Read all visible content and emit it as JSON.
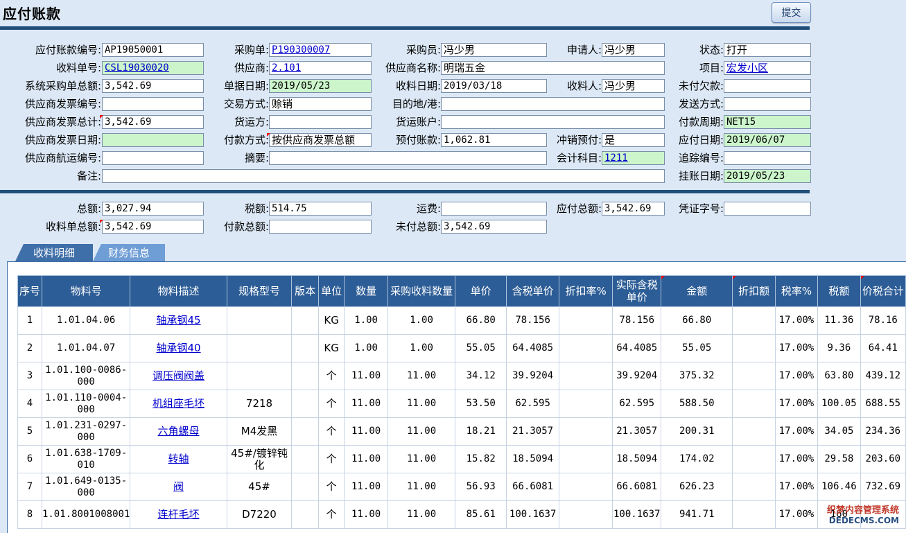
{
  "header": {
    "title": "应付账款",
    "submit_label": "提交"
  },
  "form": {
    "ap_no": {
      "label": "应付账款编号:",
      "value": "AP19050001"
    },
    "po": {
      "label": "采购单:",
      "value": "P190300007"
    },
    "buyer": {
      "label": "采购员:",
      "value": "冯少男"
    },
    "requester": {
      "label": "申请人:",
      "value": "冯少男"
    },
    "status": {
      "label": "状态:",
      "value": "打开"
    },
    "receipt_no": {
      "label": "收料单号:",
      "value": "CSL19030020"
    },
    "supplier": {
      "label": "供应商:",
      "value": "2.101"
    },
    "supplier_name": {
      "label": "供应商名称:",
      "value": "明瑞五金"
    },
    "project": {
      "label": "项目:",
      "value": "宏发小区"
    },
    "sys_po_total": {
      "label": "系统采购单总额:",
      "value": "3,542.69"
    },
    "doc_date": {
      "label": "单据日期:",
      "value": "2019/05/23"
    },
    "receipt_date": {
      "label": "收料日期:",
      "value": "2019/03/18"
    },
    "receiver": {
      "label": "收料人:",
      "value": "冯少男"
    },
    "unpaid_debt": {
      "label": "未付欠款:",
      "value": ""
    },
    "supplier_invoice_no": {
      "label": "供应商发票编号:",
      "value": ""
    },
    "trade_method": {
      "label": "交易方式:",
      "value": "赊销"
    },
    "destination": {
      "label": "目的地/港:",
      "value": ""
    },
    "ship_method": {
      "label": "发送方式:",
      "value": ""
    },
    "supplier_invoice_total": {
      "label": "供应商发票总计:",
      "value": "3,542.69"
    },
    "carrier": {
      "label": "货运方:",
      "value": ""
    },
    "freight_account": {
      "label": "货运账户:",
      "value": ""
    },
    "payment_term": {
      "label": "付款周期:",
      "value": "NET15"
    },
    "supplier_invoice_date": {
      "label": "供应商发票日期:",
      "value": ""
    },
    "payment_method": {
      "label": "付款方式:",
      "value": "按供应商发票总额"
    },
    "prepaid": {
      "label": "预付账款:",
      "value": "1,062.81"
    },
    "offset_prepaid": {
      "label": "冲销预付:",
      "value": "是"
    },
    "due_date": {
      "label": "应付日期:",
      "value": "2019/06/07"
    },
    "supplier_shipping_no": {
      "label": "供应商航运编号:",
      "value": ""
    },
    "summary": {
      "label": "摘要:",
      "value": ""
    },
    "account_subject": {
      "label": "会计科目:",
      "value": "1211"
    },
    "tracking_no": {
      "label": "追踪编号:",
      "value": ""
    },
    "remark": {
      "label": "备注:",
      "value": ""
    },
    "posting_date": {
      "label": "挂账日期:",
      "value": "2019/05/23"
    }
  },
  "totals": {
    "total": {
      "label": "总额:",
      "value": "3,027.94"
    },
    "tax": {
      "label": "税额:",
      "value": "514.75"
    },
    "freight": {
      "label": "运费:",
      "value": ""
    },
    "payable_total": {
      "label": "应付总额:",
      "value": "3,542.69"
    },
    "voucher_no": {
      "label": "凭证字号:",
      "value": ""
    },
    "receipt_total": {
      "label": "收料单总额:",
      "value": "3,542.69"
    },
    "paid_total": {
      "label": "付款总额:",
      "value": ""
    },
    "unpaid_total": {
      "label": "未付总额:",
      "value": "3,542.69"
    }
  },
  "tabs": [
    {
      "label": "收料明细",
      "active": true
    },
    {
      "label": "财务信息",
      "active": false
    }
  ],
  "table": {
    "columns": [
      "序号",
      "物料号",
      "物料描述",
      "规格型号",
      "版本",
      "单位",
      "数量",
      "采购收料数量",
      "单价",
      "含税单价",
      "折扣率%",
      "实际含税单价",
      "金额",
      "折扣额",
      "税率%",
      "税额",
      "价税合计"
    ],
    "rows": [
      [
        "1",
        "1.01.04.06",
        "轴承钢45",
        "",
        "",
        "KG",
        "1.00",
        "1.00",
        "66.80",
        "78.156",
        "",
        "78.156",
        "66.80",
        "",
        "17.00%",
        "11.36",
        "78.16"
      ],
      [
        "2",
        "1.01.04.07",
        "轴承钢40",
        "",
        "",
        "KG",
        "1.00",
        "1.00",
        "55.05",
        "64.4085",
        "",
        "64.4085",
        "55.05",
        "",
        "17.00%",
        "9.36",
        "64.41"
      ],
      [
        "3",
        "1.01.100-0086-000",
        "调压阀阀盖",
        "",
        "",
        "个",
        "11.00",
        "11.00",
        "34.12",
        "39.9204",
        "",
        "39.9204",
        "375.32",
        "",
        "17.00%",
        "63.80",
        "439.12"
      ],
      [
        "4",
        "1.01.110-0004-000",
        "机组座毛坯",
        "7218",
        "",
        "个",
        "11.00",
        "11.00",
        "53.50",
        "62.595",
        "",
        "62.595",
        "588.50",
        "",
        "17.00%",
        "100.05",
        "688.55"
      ],
      [
        "5",
        "1.01.231-0297-000",
        "六角螺母",
        "M4发黑",
        "",
        "个",
        "11.00",
        "11.00",
        "18.21",
        "21.3057",
        "",
        "21.3057",
        "200.31",
        "",
        "17.00%",
        "34.05",
        "234.36"
      ],
      [
        "6",
        "1.01.638-1709-010",
        "转轴",
        "45#/镀锌钝化",
        "",
        "个",
        "11.00",
        "11.00",
        "15.82",
        "18.5094",
        "",
        "18.5094",
        "174.02",
        "",
        "17.00%",
        "29.58",
        "203.60"
      ],
      [
        "7",
        "1.01.649-0135-000",
        "阀",
        "45#",
        "",
        "个",
        "11.00",
        "11.00",
        "56.93",
        "66.6081",
        "",
        "66.6081",
        "626.23",
        "",
        "17.00%",
        "106.46",
        "732.69"
      ],
      [
        "8",
        "1.01.8001008001",
        "连杆毛坯",
        "D7220",
        "",
        "个",
        "11.00",
        "11.00",
        "85.61",
        "100.1637",
        "",
        "100.1637",
        "941.71",
        "",
        "17.00%",
        "160",
        ""
      ]
    ]
  },
  "watermark": {
    "line1": "织梦内容管理系统",
    "line2": "DEDECMS.COM"
  }
}
